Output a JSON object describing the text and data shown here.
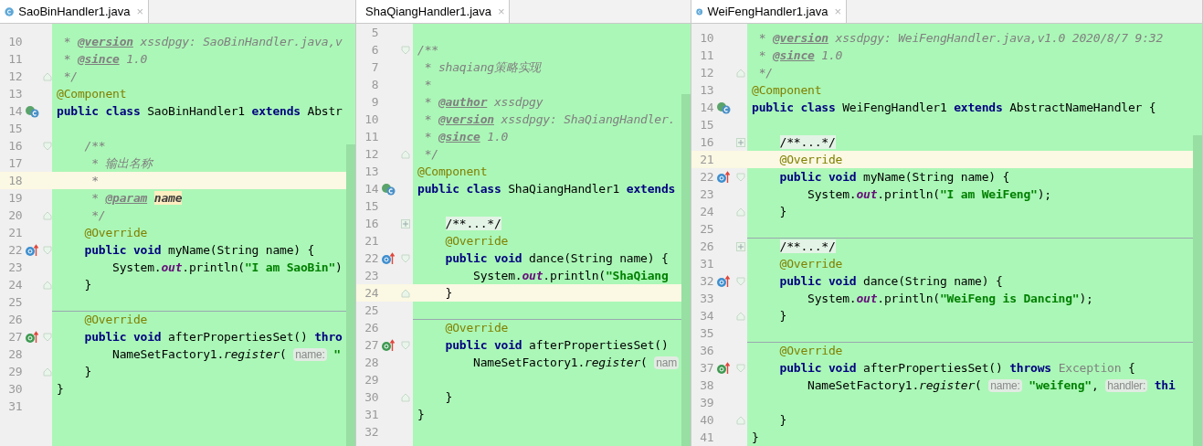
{
  "panes": [
    {
      "tab": {
        "title": "SaoBinHandler1.java",
        "close": "×",
        "selected": true
      },
      "lines": [
        {
          "number": "10",
          "current": false,
          "separator": false,
          "tokens": [
            {
              "kind": "comment",
              "text": " * "
            },
            {
              "kind": "doctag",
              "text": "@version"
            },
            {
              "kind": "comment",
              "text": " xssdpgy: SaoBinHandler.java,v"
            }
          ]
        },
        {
          "number": "11",
          "current": false,
          "separator": false,
          "tokens": [
            {
              "kind": "comment",
              "text": " * "
            },
            {
              "kind": "doctag",
              "text": "@since"
            },
            {
              "kind": "comment",
              "text": " 1.0"
            }
          ]
        },
        {
          "number": "12",
          "current": false,
          "separator": false,
          "fold": {
            "kind": "end"
          },
          "tokens": [
            {
              "kind": "comment",
              "text": " */"
            }
          ]
        },
        {
          "number": "13",
          "current": false,
          "separator": false,
          "tokens": [
            {
              "kind": "annotation",
              "text": "@Component"
            }
          ]
        },
        {
          "number": "14",
          "current": false,
          "separator": false,
          "marker": {
            "kind": "class"
          },
          "tokens": [
            {
              "kind": "keyword",
              "text": "public class"
            },
            {
              "kind": "plain",
              "text": " SaoBinHandler1 "
            },
            {
              "kind": "keyword",
              "text": "extends"
            },
            {
              "kind": "plain",
              "text": " Abstr"
            }
          ]
        },
        {
          "number": "15",
          "current": false,
          "separator": false
        },
        {
          "number": "16",
          "current": false,
          "separator": false,
          "fold": {
            "kind": "start"
          },
          "tokens": [
            {
              "kind": "comment",
              "text": "    /**"
            }
          ]
        },
        {
          "number": "17",
          "current": false,
          "separator": false,
          "tokens": [
            {
              "kind": "comment",
              "text": "     * 输出名称"
            }
          ]
        },
        {
          "number": "18",
          "current": true,
          "separator": false,
          "tokens": [
            {
              "kind": "comment",
              "text": "     *"
            }
          ]
        },
        {
          "number": "19",
          "current": false,
          "separator": false,
          "tokens": [
            {
              "kind": "comment",
              "text": "     * "
            },
            {
              "kind": "doctag",
              "text": "@param"
            },
            {
              "kind": "param",
              "text": " name"
            }
          ]
        },
        {
          "number": "20",
          "current": false,
          "separator": false,
          "fold": {
            "kind": "end"
          },
          "tokens": [
            {
              "kind": "comment",
              "text": "     */"
            }
          ]
        },
        {
          "number": "21",
          "current": false,
          "separator": false,
          "tokens": [
            {
              "kind": "annotation",
              "text": "    @Override"
            }
          ]
        },
        {
          "number": "22",
          "current": false,
          "separator": false,
          "fold": {
            "kind": "start"
          },
          "marker": {
            "kind": "method"
          },
          "tokens": [
            {
              "kind": "keyword",
              "text": "    public void"
            },
            {
              "kind": "plain",
              "text": " myName(String name) {"
            }
          ]
        },
        {
          "number": "23",
          "current": false,
          "separator": false,
          "tokens": [
            {
              "kind": "plain",
              "text": "        System."
            },
            {
              "kind": "field",
              "text": "out"
            },
            {
              "kind": "plain",
              "text": ".println("
            },
            {
              "kind": "string",
              "text": "\"I am SaoBin\""
            },
            {
              "kind": "plain",
              "text": ")"
            }
          ]
        },
        {
          "number": "24",
          "current": false,
          "separator": false,
          "fold": {
            "kind": "end"
          },
          "tokens": [
            {
              "kind": "plain",
              "text": "    }"
            }
          ]
        },
        {
          "number": "25",
          "current": false,
          "separator": false
        },
        {
          "number": "26",
          "current": false,
          "separator": true,
          "tokens": [
            {
              "kind": "annotation",
              "text": "    @Override"
            }
          ]
        },
        {
          "number": "27",
          "current": false,
          "separator": false,
          "fold": {
            "kind": "start"
          },
          "marker": {
            "kind": "interface"
          },
          "tokens": [
            {
              "kind": "keyword",
              "text": "    public void"
            },
            {
              "kind": "plain",
              "text": " afterPropertiesSet() "
            },
            {
              "kind": "keyword",
              "text": "thro"
            }
          ]
        },
        {
          "number": "28",
          "current": false,
          "separator": false,
          "tokens": [
            {
              "kind": "plain",
              "text": "        NameSetFactory1."
            },
            {
              "kind": "italic",
              "text": "register"
            },
            {
              "kind": "plain",
              "text": "("
            },
            {
              "kind": "hint",
              "text": " name:"
            },
            {
              "kind": "string",
              "text": " \""
            }
          ]
        },
        {
          "number": "29",
          "current": false,
          "separator": false,
          "fold": {
            "kind": "end"
          },
          "tokens": [
            {
              "kind": "plain",
              "text": "    }"
            }
          ]
        },
        {
          "number": "30",
          "current": false,
          "separator": false,
          "tokens": [
            {
              "kind": "plain",
              "text": "}"
            }
          ]
        },
        {
          "number": "31",
          "current": false,
          "separator": false
        }
      ]
    },
    {
      "tab": {
        "title": "ShaQiangHandler1.java",
        "close": "×",
        "selected": true
      },
      "lines": [
        {
          "number": "5",
          "current": false,
          "separator": false
        },
        {
          "number": "6",
          "current": false,
          "separator": false,
          "fold": {
            "kind": "start"
          },
          "tokens": [
            {
              "kind": "comment",
              "text": "/**"
            }
          ]
        },
        {
          "number": "7",
          "current": false,
          "separator": false,
          "tokens": [
            {
              "kind": "comment",
              "text": " * shaqiang策略实现"
            }
          ]
        },
        {
          "number": "8",
          "current": false,
          "separator": false,
          "tokens": [
            {
              "kind": "comment",
              "text": " *"
            }
          ]
        },
        {
          "number": "9",
          "current": false,
          "separator": false,
          "tokens": [
            {
              "kind": "comment",
              "text": " * "
            },
            {
              "kind": "doctag",
              "text": "@author"
            },
            {
              "kind": "comment",
              "text": " xssdpgy"
            }
          ]
        },
        {
          "number": "10",
          "current": false,
          "separator": false,
          "tokens": [
            {
              "kind": "comment",
              "text": " * "
            },
            {
              "kind": "doctag",
              "text": "@version"
            },
            {
              "kind": "comment",
              "text": " xssdpgy: ShaQiangHandler."
            }
          ]
        },
        {
          "number": "11",
          "current": false,
          "separator": false,
          "tokens": [
            {
              "kind": "comment",
              "text": " * "
            },
            {
              "kind": "doctag",
              "text": "@since"
            },
            {
              "kind": "comment",
              "text": " 1.0"
            }
          ]
        },
        {
          "number": "12",
          "current": false,
          "separator": false,
          "fold": {
            "kind": "end"
          },
          "tokens": [
            {
              "kind": "comment",
              "text": " */"
            }
          ]
        },
        {
          "number": "13",
          "current": false,
          "separator": false,
          "tokens": [
            {
              "kind": "annotation",
              "text": "@Component"
            }
          ]
        },
        {
          "number": "14",
          "current": false,
          "separator": false,
          "marker": {
            "kind": "class"
          },
          "tokens": [
            {
              "kind": "keyword",
              "text": "public class"
            },
            {
              "kind": "plain",
              "text": " ShaQiangHandler1 "
            },
            {
              "kind": "keyword",
              "text": "extends"
            }
          ]
        },
        {
          "number": "15",
          "current": false,
          "separator": false
        },
        {
          "number": "16",
          "current": false,
          "separator": false,
          "fold": {
            "kind": "collapsed"
          },
          "tokens": [
            {
              "kind": "folded",
              "text": "    /**...*/"
            }
          ]
        },
        {
          "number": "21",
          "current": false,
          "separator": false,
          "tokens": [
            {
              "kind": "annotation",
              "text": "    @Override"
            }
          ]
        },
        {
          "number": "22",
          "current": false,
          "separator": false,
          "fold": {
            "kind": "start"
          },
          "marker": {
            "kind": "method"
          },
          "tokens": [
            {
              "kind": "keyword",
              "text": "    public void"
            },
            {
              "kind": "plain",
              "text": " dance(String name) {"
            }
          ]
        },
        {
          "number": "23",
          "current": false,
          "separator": false,
          "tokens": [
            {
              "kind": "plain",
              "text": "        System."
            },
            {
              "kind": "field",
              "text": "out"
            },
            {
              "kind": "plain",
              "text": ".println("
            },
            {
              "kind": "string",
              "text": "\"ShaQiang"
            }
          ]
        },
        {
          "number": "24",
          "current": true,
          "separator": false,
          "fold": {
            "kind": "end"
          },
          "tokens": [
            {
              "kind": "plain",
              "text": "    }"
            }
          ]
        },
        {
          "number": "25",
          "current": false,
          "separator": false
        },
        {
          "number": "26",
          "current": false,
          "separator": true,
          "tokens": [
            {
              "kind": "annotation",
              "text": "    @Override"
            }
          ]
        },
        {
          "number": "27",
          "current": false,
          "separator": false,
          "fold": {
            "kind": "start"
          },
          "marker": {
            "kind": "interface"
          },
          "tokens": [
            {
              "kind": "keyword",
              "text": "    public void"
            },
            {
              "kind": "plain",
              "text": " afterPropertiesSet()"
            }
          ]
        },
        {
          "number": "28",
          "current": false,
          "separator": false,
          "tokens": [
            {
              "kind": "plain",
              "text": "        NameSetFactory1."
            },
            {
              "kind": "italic",
              "text": "register"
            },
            {
              "kind": "plain",
              "text": "("
            },
            {
              "kind": "hint",
              "text": " nam"
            }
          ]
        },
        {
          "number": "29",
          "current": false,
          "separator": false
        },
        {
          "number": "30",
          "current": false,
          "separator": false,
          "fold": {
            "kind": "end"
          },
          "tokens": [
            {
              "kind": "plain",
              "text": "    }"
            }
          ]
        },
        {
          "number": "31",
          "current": false,
          "separator": false,
          "tokens": [
            {
              "kind": "plain",
              "text": "}"
            }
          ]
        },
        {
          "number": "32",
          "current": false,
          "separator": false
        }
      ]
    },
    {
      "tab": {
        "title": "WeiFengHandler1.java",
        "close": "×",
        "selected": true
      },
      "lines": [
        {
          "number": "10",
          "current": false,
          "separator": false,
          "tokens": [
            {
              "kind": "comment",
              "text": " * "
            },
            {
              "kind": "doctag",
              "text": "@version"
            },
            {
              "kind": "comment",
              "text": " xssdpgy: WeiFengHandler.java,v1.0 2020/8/7 9:32"
            }
          ]
        },
        {
          "number": "11",
          "current": false,
          "separator": false,
          "tokens": [
            {
              "kind": "comment",
              "text": " * "
            },
            {
              "kind": "doctag",
              "text": "@since"
            },
            {
              "kind": "comment",
              "text": " 1.0"
            }
          ]
        },
        {
          "number": "12",
          "current": false,
          "separator": false,
          "fold": {
            "kind": "end"
          },
          "tokens": [
            {
              "kind": "comment",
              "text": " */"
            }
          ]
        },
        {
          "number": "13",
          "current": false,
          "separator": false,
          "tokens": [
            {
              "kind": "annotation",
              "text": "@Component"
            }
          ]
        },
        {
          "number": "14",
          "current": false,
          "separator": false,
          "marker": {
            "kind": "class"
          },
          "tokens": [
            {
              "kind": "keyword",
              "text": "public class"
            },
            {
              "kind": "plain",
              "text": " WeiFengHandler1 "
            },
            {
              "kind": "keyword",
              "text": "extends"
            },
            {
              "kind": "plain",
              "text": " AbstractNameHandler {"
            }
          ]
        },
        {
          "number": "15",
          "current": false,
          "separator": false
        },
        {
          "number": "16",
          "current": false,
          "separator": false,
          "fold": {
            "kind": "collapsed"
          },
          "tokens": [
            {
              "kind": "folded",
              "text": "    /**...*/"
            }
          ]
        },
        {
          "number": "21",
          "current": true,
          "separator": false,
          "tokens": [
            {
              "kind": "annotation",
              "text": "    @Override"
            }
          ]
        },
        {
          "number": "22",
          "current": false,
          "separator": false,
          "fold": {
            "kind": "start"
          },
          "marker": {
            "kind": "method"
          },
          "tokens": [
            {
              "kind": "keyword",
              "text": "    public void"
            },
            {
              "kind": "plain",
              "text": " myName(String name) {"
            }
          ]
        },
        {
          "number": "23",
          "current": false,
          "separator": false,
          "tokens": [
            {
              "kind": "plain",
              "text": "        System."
            },
            {
              "kind": "field",
              "text": "out"
            },
            {
              "kind": "plain",
              "text": ".println("
            },
            {
              "kind": "string",
              "text": "\"I am WeiFeng\""
            },
            {
              "kind": "plain",
              "text": ");"
            }
          ]
        },
        {
          "number": "24",
          "current": false,
          "separator": false,
          "fold": {
            "kind": "end"
          },
          "tokens": [
            {
              "kind": "plain",
              "text": "    }"
            }
          ]
        },
        {
          "number": "25",
          "current": false,
          "separator": false
        },
        {
          "number": "26",
          "current": false,
          "separator": true,
          "fold": {
            "kind": "collapsed"
          },
          "tokens": [
            {
              "kind": "folded",
              "text": "    /**...*/"
            }
          ]
        },
        {
          "number": "31",
          "current": false,
          "separator": false,
          "tokens": [
            {
              "kind": "annotation",
              "text": "    @Override"
            }
          ]
        },
        {
          "number": "32",
          "current": false,
          "separator": false,
          "fold": {
            "kind": "start"
          },
          "marker": {
            "kind": "method"
          },
          "tokens": [
            {
              "kind": "keyword",
              "text": "    public void"
            },
            {
              "kind": "plain",
              "text": " dance(String name) {"
            }
          ]
        },
        {
          "number": "33",
          "current": false,
          "separator": false,
          "tokens": [
            {
              "kind": "plain",
              "text": "        System."
            },
            {
              "kind": "field",
              "text": "out"
            },
            {
              "kind": "plain",
              "text": ".println("
            },
            {
              "kind": "string",
              "text": "\"WeiFeng is Dancing\""
            },
            {
              "kind": "plain",
              "text": ");"
            }
          ]
        },
        {
          "number": "34",
          "current": false,
          "separator": false,
          "fold": {
            "kind": "end"
          },
          "tokens": [
            {
              "kind": "plain",
              "text": "    }"
            }
          ]
        },
        {
          "number": "35",
          "current": false,
          "separator": false
        },
        {
          "number": "36",
          "current": false,
          "separator": true,
          "tokens": [
            {
              "kind": "annotation",
              "text": "    @Override"
            }
          ]
        },
        {
          "number": "37",
          "current": false,
          "separator": false,
          "fold": {
            "kind": "start"
          },
          "marker": {
            "kind": "interface"
          },
          "tokens": [
            {
              "kind": "keyword",
              "text": "    public void"
            },
            {
              "kind": "plain",
              "text": " afterPropertiesSet() "
            },
            {
              "kind": "keyword",
              "text": "throws"
            },
            {
              "kind": "unused",
              "text": " Exception"
            },
            {
              "kind": "plain",
              "text": " {"
            }
          ]
        },
        {
          "number": "38",
          "current": false,
          "separator": false,
          "tokens": [
            {
              "kind": "plain",
              "text": "        NameSetFactory1."
            },
            {
              "kind": "italic",
              "text": "register"
            },
            {
              "kind": "plain",
              "text": "("
            },
            {
              "kind": "hint",
              "text": " name:"
            },
            {
              "kind": "string",
              "text": " \"weifeng\""
            },
            {
              "kind": "plain",
              "text": ","
            },
            {
              "kind": "hint",
              "text": " handler:"
            },
            {
              "kind": "keyword",
              "text": " thi"
            }
          ]
        },
        {
          "number": "39",
          "current": false,
          "separator": false
        },
        {
          "number": "40",
          "current": false,
          "separator": false,
          "fold": {
            "kind": "end"
          },
          "tokens": [
            {
              "kind": "plain",
              "text": "    }"
            }
          ]
        },
        {
          "number": "41",
          "current": false,
          "separator": false,
          "tokens": [
            {
              "kind": "plain",
              "text": "}"
            }
          ]
        }
      ]
    }
  ]
}
